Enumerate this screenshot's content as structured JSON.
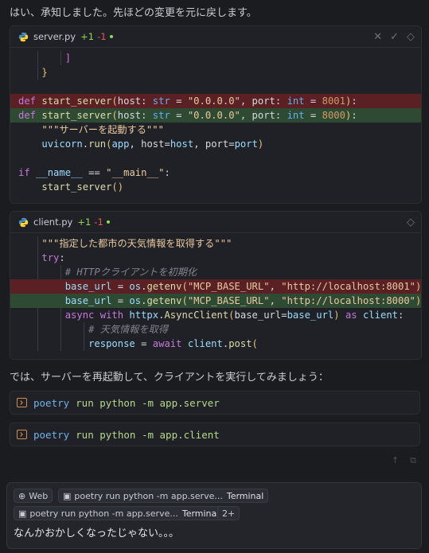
{
  "messages": {
    "intro": "はい、承知しました。先ほどの変更を元に戻します。",
    "mid": "では、サーバーを再起動して、クライアントを実行してみましょう："
  },
  "server_card": {
    "filename": "server.py",
    "plus": "+1",
    "minus": "-1",
    "icons": [
      "close-icon",
      "check-icon",
      "chevron-icon"
    ]
  },
  "client_card": {
    "filename": "client.py",
    "plus": "+1",
    "minus": "-1",
    "icons": [
      "chevron-icon"
    ]
  },
  "commands": [
    {
      "bin": "poetry",
      "rest": "run python -m app.server"
    },
    {
      "bin": "poetry",
      "rest": "run python -m app.client"
    }
  ],
  "input": {
    "chips": {
      "web": "Web",
      "term1_cmd": "poetry run python -m app.serve...",
      "term1_label": "Terminal",
      "term2_cmd": "poetry run python -m app.serve...",
      "term2_label": "Terminal",
      "more": "2+"
    },
    "text": "なんかおかしくなったじゃない。。。"
  },
  "colors": {
    "background": "#1b1c20",
    "diff_removed": "#5a2024",
    "diff_added": "#2f4a33",
    "plus": "#8fd65a",
    "minus": "#e35a5a"
  }
}
